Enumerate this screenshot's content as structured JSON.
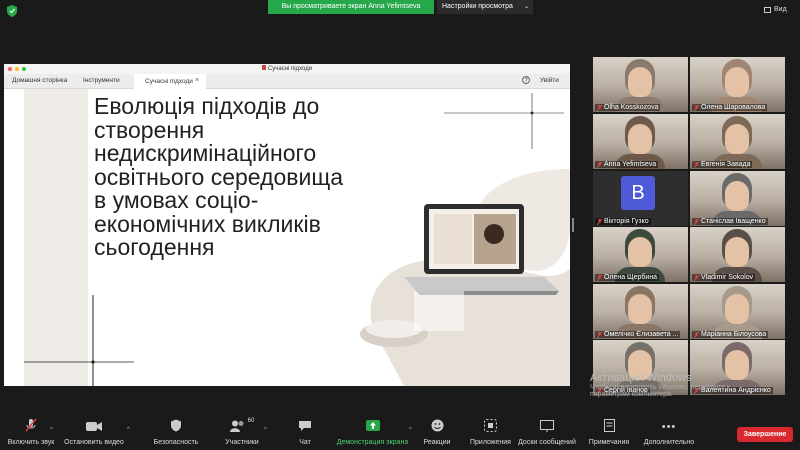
{
  "topbar": {
    "share_notice": "Вы просматриваете экран Anna Yefimtseva",
    "view_options": "Настройки просмотра",
    "view_button": "Вид"
  },
  "shared_window": {
    "title": "Сучасні підходи",
    "menu": {
      "home": "Домашня сторінка",
      "tools": "Інструменти",
      "active_tab": "Сучасні підходи",
      "signin": "Увійти"
    },
    "slide_title_lines": [
      "Еволюція підходів до",
      "створення",
      "недискримінаційного",
      "освітнього середовища",
      "в умовах соціо-",
      "економічних викликів",
      "сьогодення"
    ]
  },
  "participants": [
    {
      "name": "Olha Kosskozova",
      "muted": true,
      "active": true,
      "photo": "#8a7a6e"
    },
    {
      "name": "Олена Шаровалова",
      "muted": true,
      "active": false,
      "photo": "#a08572"
    },
    {
      "name": "Anna Yefimtseva",
      "muted": true,
      "active": false,
      "photo": "#6d5a4a"
    },
    {
      "name": "Евгенія Завада",
      "muted": true,
      "active": false,
      "photo": "#7e6a57"
    },
    {
      "name": "Вікторія Гузко",
      "muted": true,
      "active": false,
      "avatar_letter": "B",
      "avatar_color": "#4f5ad8"
    },
    {
      "name": "Станіслав Іващенко",
      "muted": true,
      "active": false,
      "photo": "#6a6a6a"
    },
    {
      "name": "Олена Щербина",
      "muted": true,
      "active": false,
      "photo": "#3f4a3f"
    },
    {
      "name": "Vladimir Sokolov",
      "muted": true,
      "active": false,
      "photo": "#5a4e48"
    },
    {
      "name": "Омелічко Єлизавета ...",
      "muted": true,
      "active": false,
      "photo": "#8b7666"
    },
    {
      "name": "Маріанна Білоусова",
      "muted": true,
      "active": false,
      "photo": "#a89a8a"
    },
    {
      "name": "Сергій Іванов",
      "muted": true,
      "active": false,
      "photo": "#777068"
    },
    {
      "name": "Валентина Андрієнко",
      "muted": true,
      "active": false,
      "photo": "#7a6a6a"
    }
  ],
  "watermark": {
    "line1": "Активация Windows",
    "line2": "Чтобы активировать Windows, перейдите к",
    "line3": "параметрам компьютера."
  },
  "toolbar": {
    "unmute": "Включить звук",
    "stop_video": "Остановить видео",
    "security": "Безопасность",
    "participants": "Участники",
    "participants_count": "60",
    "chat": "Чат",
    "share_screen": "Демонстрация экрана",
    "reactions": "Реакции",
    "apps": "Приложения",
    "whiteboards": "Доски сообщений",
    "notes": "Примечания",
    "more": "Дополнительно",
    "end": "Завершение"
  },
  "colors": {
    "accent_green": "#26a84a",
    "end_red": "#d9292e",
    "active_border": "#e6e63c",
    "muted_red": "#e04040"
  }
}
